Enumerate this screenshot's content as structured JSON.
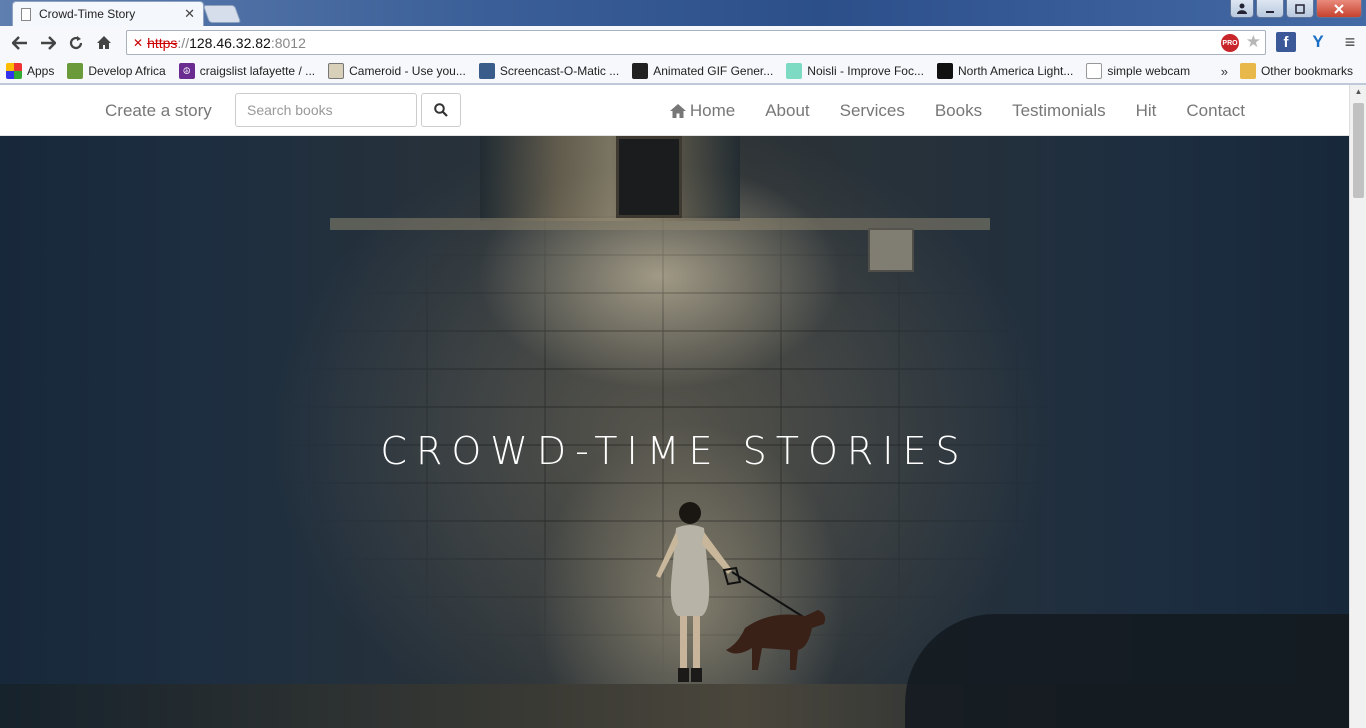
{
  "browser": {
    "tab_title": "Crowd-Time Story",
    "tab_close": "✕",
    "url_scheme": "https",
    "url_sep": "://",
    "url_host": "128.46.32.82",
    "url_port": ":8012",
    "pro_badge": "PRO",
    "bookmarks": [
      {
        "label": "Apps",
        "icon": "apps-icon"
      },
      {
        "label": "Develop Africa",
        "icon": "develop-africa-icon"
      },
      {
        "label": "craigslist lafayette / ...",
        "icon": "peace-icon"
      },
      {
        "label": "Cameroid - Use you...",
        "icon": "cameroid-icon"
      },
      {
        "label": "Screencast-O-Matic ...",
        "icon": "screencast-icon"
      },
      {
        "label": "Animated GIF Gener...",
        "icon": "gif-icon"
      },
      {
        "label": "Noisli - Improve Foc...",
        "icon": "noisli-icon"
      },
      {
        "label": "North America Light...",
        "icon": "nal-icon"
      },
      {
        "label": "simple webcam",
        "icon": "page-icon"
      }
    ],
    "bookmarks_more": "»",
    "other_bookmarks": "Other bookmarks"
  },
  "navbar": {
    "brand": "Create a story",
    "search_placeholder": "Search books",
    "links": {
      "home": "Home",
      "about": "About",
      "services": "Services",
      "books": "Books",
      "testimonials": "Testimonials",
      "hit": "Hit",
      "contact": "Contact"
    }
  },
  "hero": {
    "title": "CROWD-TIME STORIES"
  }
}
